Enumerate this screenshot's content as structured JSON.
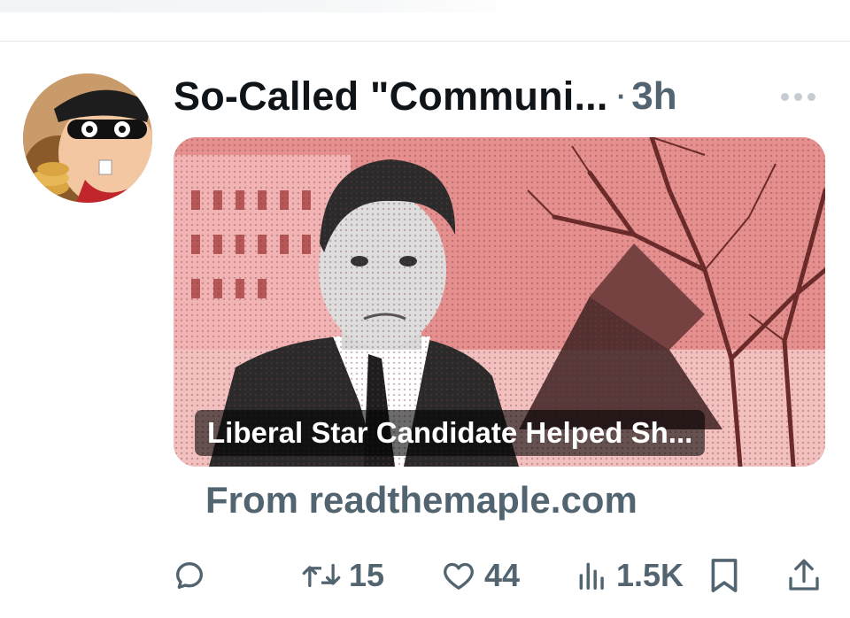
{
  "tweet": {
    "display_name": "So-Called \"Communi...",
    "separator": "·",
    "timestamp": "3h",
    "more_icon": "more-horizontal-icon"
  },
  "link_card": {
    "headline": "Liberal Star Candidate Helped Sh...",
    "source": "From readthemaple.com"
  },
  "actions": {
    "reply": {
      "icon": "reply-icon",
      "count": ""
    },
    "retweet": {
      "icon": "retweet-icon",
      "count": "15"
    },
    "like": {
      "icon": "heart-icon",
      "count": "44"
    },
    "views": {
      "icon": "analytics-icon",
      "count": "1.5K"
    },
    "bookmark": {
      "icon": "bookmark-icon"
    },
    "share": {
      "icon": "share-icon"
    }
  },
  "colors": {
    "text_primary": "#0f1419",
    "text_secondary": "#536471",
    "card_tint": "#e88a8a"
  }
}
